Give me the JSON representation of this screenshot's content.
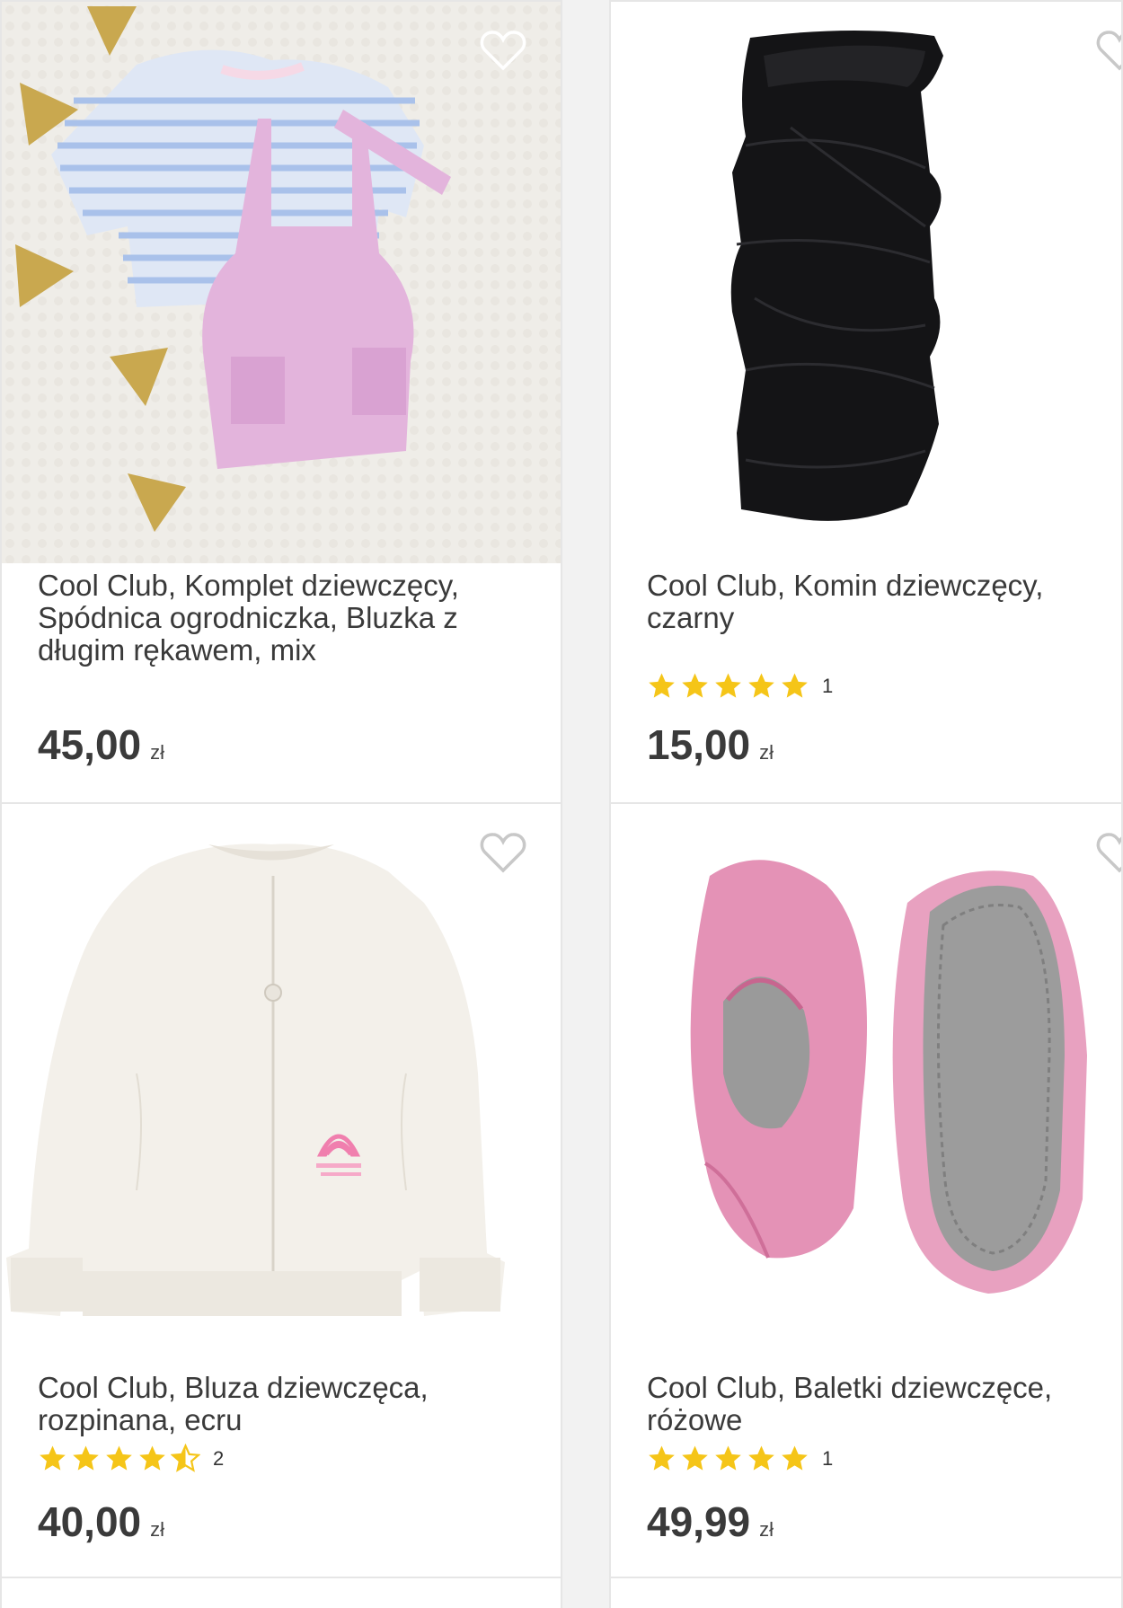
{
  "products": [
    {
      "title": "Cool Club, Komplet dziewczęcy, Spódnica ogrodniczka, Bluzka z długim rękawem, mix",
      "price": "45,00",
      "currency": "zł"
    },
    {
      "title": "Cool Club, Komin dziewczęcy, czarny",
      "price": "15,00",
      "currency": "zł",
      "rating": 5,
      "review_count": "1"
    },
    {
      "title": "Cool Club, Bluza dziewczęca, rozpinana, ecru",
      "price": "40,00",
      "currency": "zł",
      "rating": 4.5,
      "review_count": "2"
    },
    {
      "title": "Cool Club, Baletki dziewczęce, różowe",
      "price": "49,99",
      "currency": "zł",
      "rating": 5,
      "review_count": "1"
    }
  ],
  "colors": {
    "star": "#f5c518",
    "text": "#3a3a3a",
    "border": "#e6e6e6"
  },
  "icons": {
    "favorite": "heart-outline-icon",
    "rating": "star-icon"
  }
}
